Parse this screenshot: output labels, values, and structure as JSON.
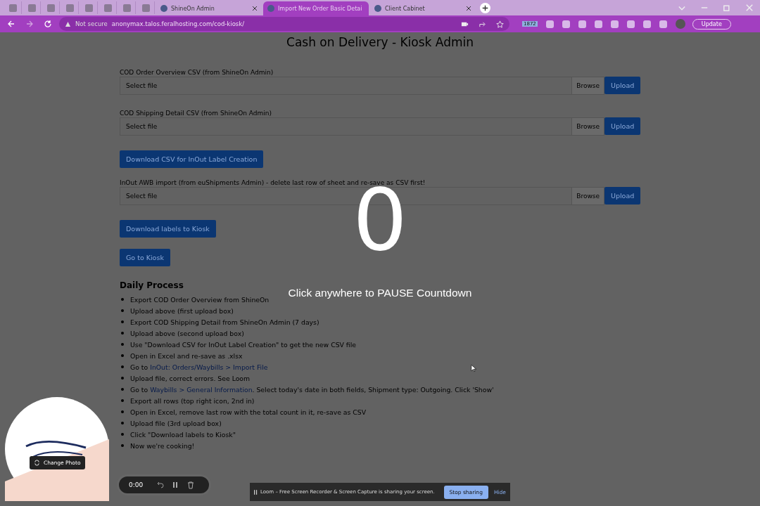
{
  "browser": {
    "tabs": [
      {
        "title": "ShineOn Admin",
        "selected": false
      },
      {
        "title": "Import New Order Basic Detai",
        "selected": true
      },
      {
        "title": "Client Cabinet",
        "selected": false
      }
    ],
    "security": "Not secure",
    "url": "anonymax.talos.feralhosting.com/cod-kiosk/",
    "extension_badge": "1872",
    "update_button": "Update"
  },
  "page": {
    "title": "Cash on Delivery - Kiosk Admin",
    "blocks": [
      {
        "kind": "upload",
        "label": "COD Order Overview CSV (from ShineOn Admin)",
        "placeholder": "Select file",
        "browse": "Browse",
        "upload": "Upload"
      },
      {
        "kind": "upload",
        "label": "COD Shipping Detail CSV (from ShineOn Admin)",
        "placeholder": "Select file",
        "browse": "Browse",
        "upload": "Upload"
      },
      {
        "kind": "button",
        "label": "Download CSV for InOut Label Creation"
      },
      {
        "kind": "upload",
        "label": "InOut AWB import (from euShipments Admin) - delete last row of sheet and re-save as CSV first!",
        "placeholder": "Select file",
        "browse": "Browse",
        "upload": "Upload"
      },
      {
        "kind": "button",
        "label": "Download labels to Kiosk"
      },
      {
        "kind": "button",
        "label": "Go to Kiosk"
      }
    ],
    "process_heading": "Daily Process",
    "steps": [
      [
        {
          "kind": "text",
          "text": "Export COD Order Overview from ShineOn"
        }
      ],
      [
        {
          "kind": "text",
          "text": "Upload above (first upload box)"
        }
      ],
      [
        {
          "kind": "text",
          "text": "Export COD Shipping Detail from ShineOn Admin (7 days)"
        }
      ],
      [
        {
          "kind": "text",
          "text": "Upload above (second upload box)"
        }
      ],
      [
        {
          "kind": "text",
          "text": "Use \"Download CSV for InOut Label Creation\" to get the new CSV file"
        }
      ],
      [
        {
          "kind": "text",
          "text": "Open in Excel and re-save as .xlsx"
        }
      ],
      [
        {
          "kind": "text",
          "text": "Go to"
        },
        {
          "kind": "link",
          "text": "InOut: Orders/Waybills > Import File"
        }
      ],
      [
        {
          "kind": "text",
          "text": "Upload file, correct errors. See Loom"
        }
      ],
      [
        {
          "kind": "text",
          "text": "Go to"
        },
        {
          "kind": "link",
          "text": "Waybills > General Information"
        },
        {
          "kind": "text",
          "text": ". Select today's date in both fields, Shipment type: Outgoing. Click 'Show'"
        }
      ],
      [
        {
          "kind": "text",
          "text": "Export all rows (top right icon, 2nd in)"
        }
      ],
      [
        {
          "kind": "text",
          "text": "Open in Excel, remove last row with the total count in it, re-save as CSV"
        }
      ],
      [
        {
          "kind": "text",
          "text": "Upload file (3rd upload box)"
        }
      ],
      [
        {
          "kind": "text",
          "text": "Click \"Download labels to Kiosk\""
        }
      ],
      [
        {
          "kind": "text",
          "text": "Now we're cooking!"
        }
      ]
    ]
  },
  "countdown": {
    "number": "0",
    "hint": "Click anywhere to PAUSE Countdown"
  },
  "recorder": {
    "change_photo": "Change Photo",
    "timer": "0:00",
    "sharing_message": "Loom – Free Screen Recorder & Screen Capture is sharing your screen.",
    "stop_sharing": "Stop sharing",
    "hide": "Hide"
  }
}
